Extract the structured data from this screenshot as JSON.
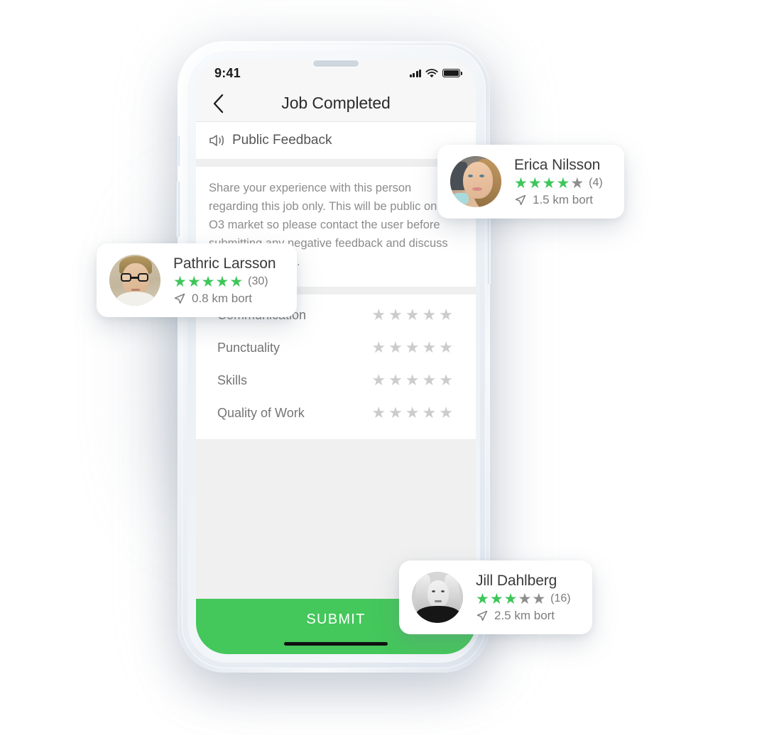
{
  "status_bar": {
    "time": "9:41",
    "signal_icon": "cellular-signal-icon",
    "wifi_icon": "wifi-icon",
    "battery_icon": "battery-full-icon"
  },
  "nav": {
    "back_icon": "chevron-left-icon",
    "title": "Job Completed"
  },
  "feedback_section": {
    "icon": "megaphone-icon",
    "label": "Public Feedback",
    "description": "Share your experience with this person regarding this job only. This will be public on the O3 market so please contact the user before submitting any negative feedback and discuss what went wrong."
  },
  "ratings": {
    "empty_star_glyph": "★",
    "max_stars": 5,
    "rows": [
      {
        "label": "Communication",
        "value": 0
      },
      {
        "label": "Punctuality",
        "value": 0
      },
      {
        "label": "Skills",
        "value": 0
      },
      {
        "label": "Quality of Work",
        "value": 0
      }
    ]
  },
  "submit": {
    "label": "SUBMIT",
    "color": "#44c75b"
  },
  "colors": {
    "accent_green": "#44c75b",
    "star_on": "#3ec65a",
    "star_off": "#8e8e8e",
    "star_empty": "#cccccc",
    "screen_bg": "#f0f0f0"
  },
  "profile_cards": [
    {
      "id": "erica",
      "name": "Erica Nilsson",
      "stars_filled": 4,
      "stars_total": 5,
      "review_count": "(4)",
      "distance": "1.5 km bort",
      "distance_icon": "navigation-arrow-icon",
      "avatar": "erica-avatar"
    },
    {
      "id": "pathric",
      "name": "Pathric Larsson",
      "stars_filled": 5,
      "stars_total": 5,
      "review_count": "(30)",
      "distance": "0.8 km bort",
      "distance_icon": "navigation-arrow-icon",
      "avatar": "pathric-avatar"
    },
    {
      "id": "jill",
      "name": "Jill Dahlberg",
      "stars_filled": 3,
      "stars_total": 5,
      "review_count": "(16)",
      "distance": "2.5 km bort",
      "distance_icon": "navigation-arrow-icon",
      "avatar": "jill-avatar"
    }
  ]
}
